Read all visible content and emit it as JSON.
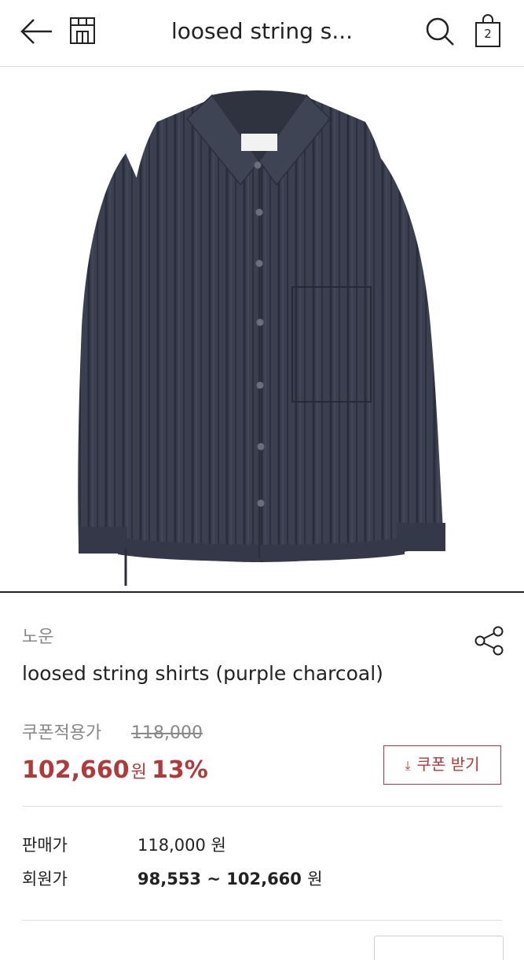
{
  "header": {
    "title": "loosed string s...",
    "cart_count": "2",
    "icons": [
      "back-arrow-icon",
      "home-shop-icon",
      "search-icon",
      "shopping-bag-icon"
    ]
  },
  "product": {
    "brand": "노운",
    "name": "loosed string shirts (purple charcoal)",
    "coupon_label": "쿠폰적용가",
    "original_price": "118,000",
    "sale_price": "102,660",
    "sale_currency": "원",
    "discount": "13%",
    "coupon_button_label": "쿠폰 받기",
    "coupon_button_icon": "download-arrow-icon"
  },
  "price_rows": [
    {
      "label": "판매가",
      "value": "118,000",
      "unit": "원"
    },
    {
      "label": "회원가",
      "value": "98,553 ~ 102,660",
      "unit": "원"
    }
  ],
  "colors": {
    "accent": "#b03a3a",
    "shirt": "#3a3f4f",
    "muted_text": "#888888"
  }
}
